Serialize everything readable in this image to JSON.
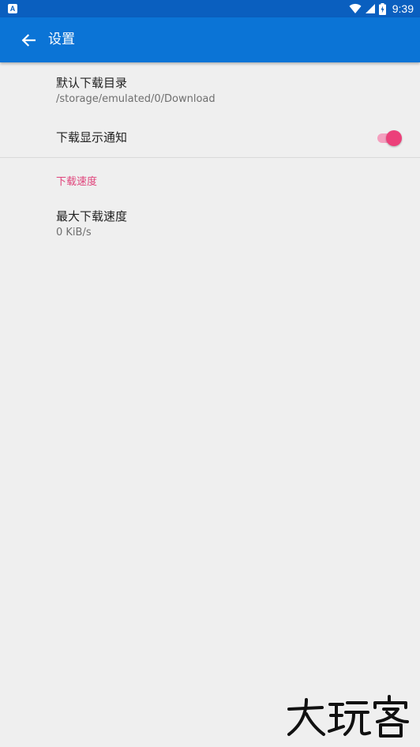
{
  "status_bar": {
    "time": "9:39",
    "notification_icon": "a-icon",
    "wifi_icon": "wifi-icon",
    "signal_icon": "signal-icon",
    "battery_icon": "battery-icon"
  },
  "app_bar": {
    "title": "设置",
    "back_icon": "arrow-back-icon"
  },
  "preferences": {
    "download_dir": {
      "title": "默认下载目录",
      "summary": "/storage/emulated/0/Download"
    },
    "show_notification": {
      "title": "下载显示通知",
      "enabled": true
    }
  },
  "categories": {
    "speed": {
      "title": "下载速度",
      "max_speed": {
        "title": "最大下载速度",
        "summary": "0 KiB/s"
      }
    }
  },
  "watermark": {
    "text": "大玩客"
  },
  "colors": {
    "status_bar": "#0a5fbf",
    "app_bar": "#0b74d6",
    "accent": "#ec407a",
    "background": "#efefef"
  }
}
